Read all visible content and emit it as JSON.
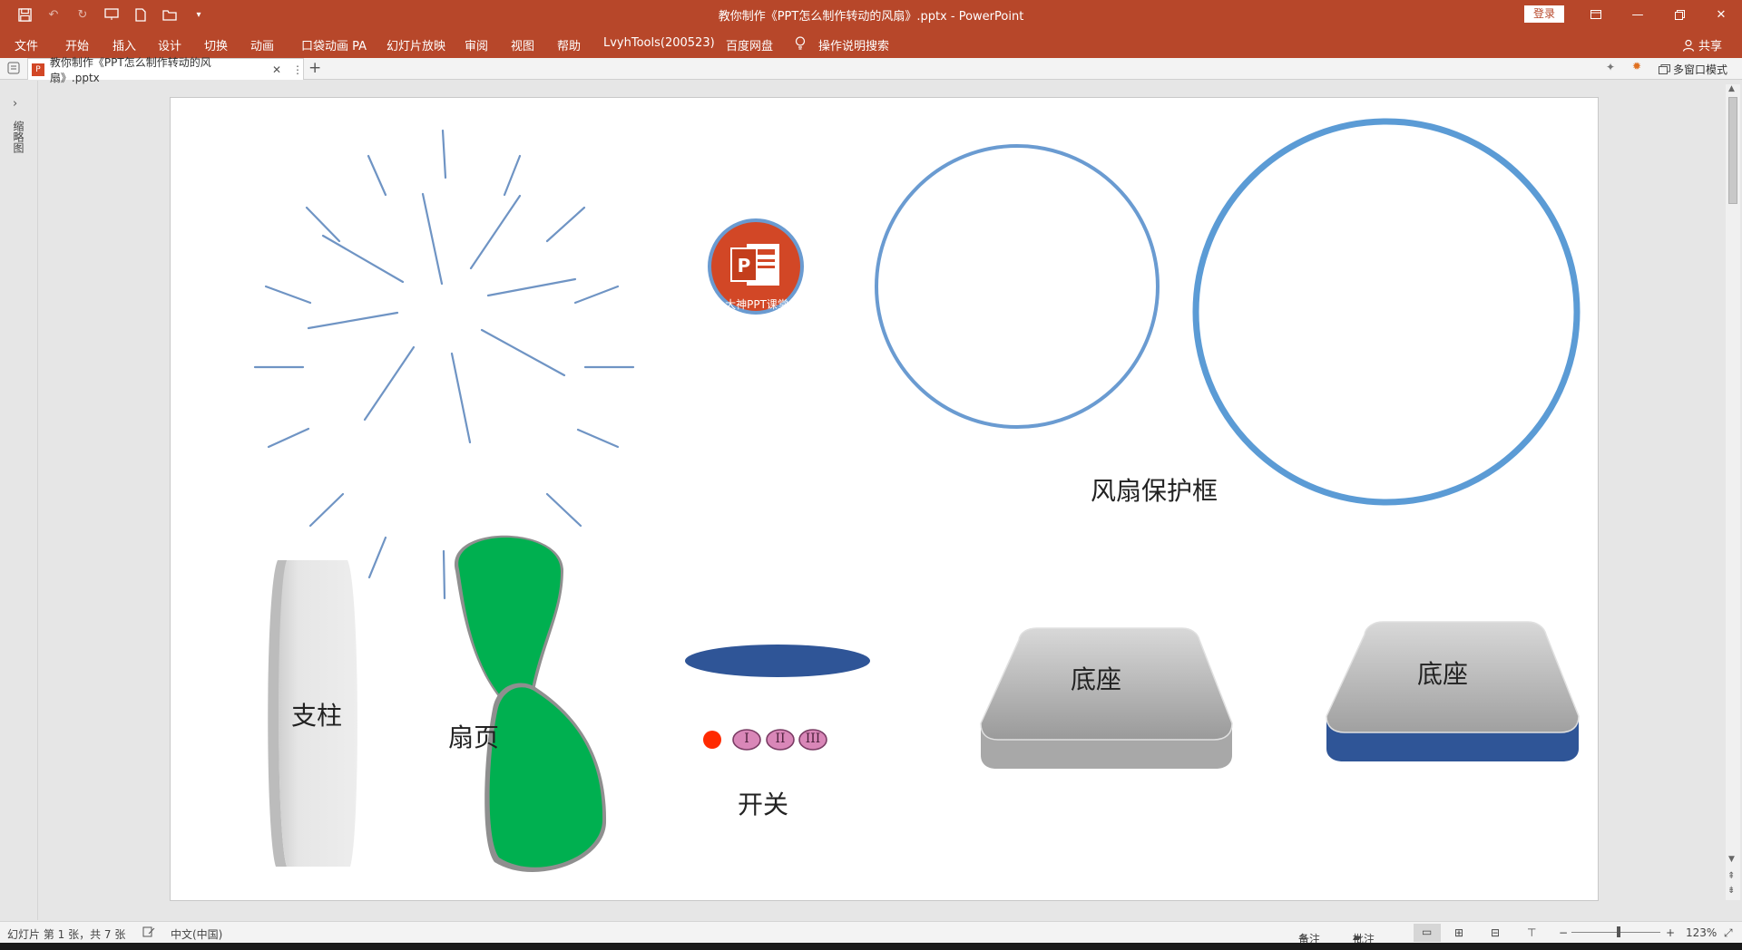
{
  "window": {
    "title": "教你制作《PPT怎么制作转动的风扇》.pptx  -  PowerPoint",
    "login": "登录"
  },
  "ribbon": {
    "tabs": [
      "文件",
      "开始",
      "插入",
      "设计",
      "切换",
      "动画",
      "口袋动画 PA",
      "幻灯片放映",
      "审阅",
      "视图",
      "帮助",
      "LvyhTools(200523)",
      "百度网盘",
      "操作说明搜索"
    ],
    "share": "共享"
  },
  "doc_tab": {
    "name": "教你制作《PPT怎么制作转动的风扇》.pptx",
    "multi_window": "多窗口模式"
  },
  "left_pane": {
    "label": "缩略图"
  },
  "slide": {
    "logo_text": "大神PPT课堂",
    "labels": {
      "guard": "风扇保护框",
      "pole": "支柱",
      "blade": "扇页",
      "switch": "开关",
      "base1": "底座",
      "base2": "底座"
    },
    "switch_buttons": [
      "I",
      "II",
      "III"
    ]
  },
  "status": {
    "slide_info": "幻灯片 第 1 张，共 7 张",
    "language": "中文(中国)",
    "notes": "备注",
    "comments": "批注",
    "zoom": "123%"
  },
  "colors": {
    "accent": "#b7472a",
    "line_blue": "#5b9bd5",
    "fan_green": "#00b050",
    "navy": "#2f5597",
    "switch_red": "#ff2a00",
    "switch_pink": "#d987b8"
  }
}
